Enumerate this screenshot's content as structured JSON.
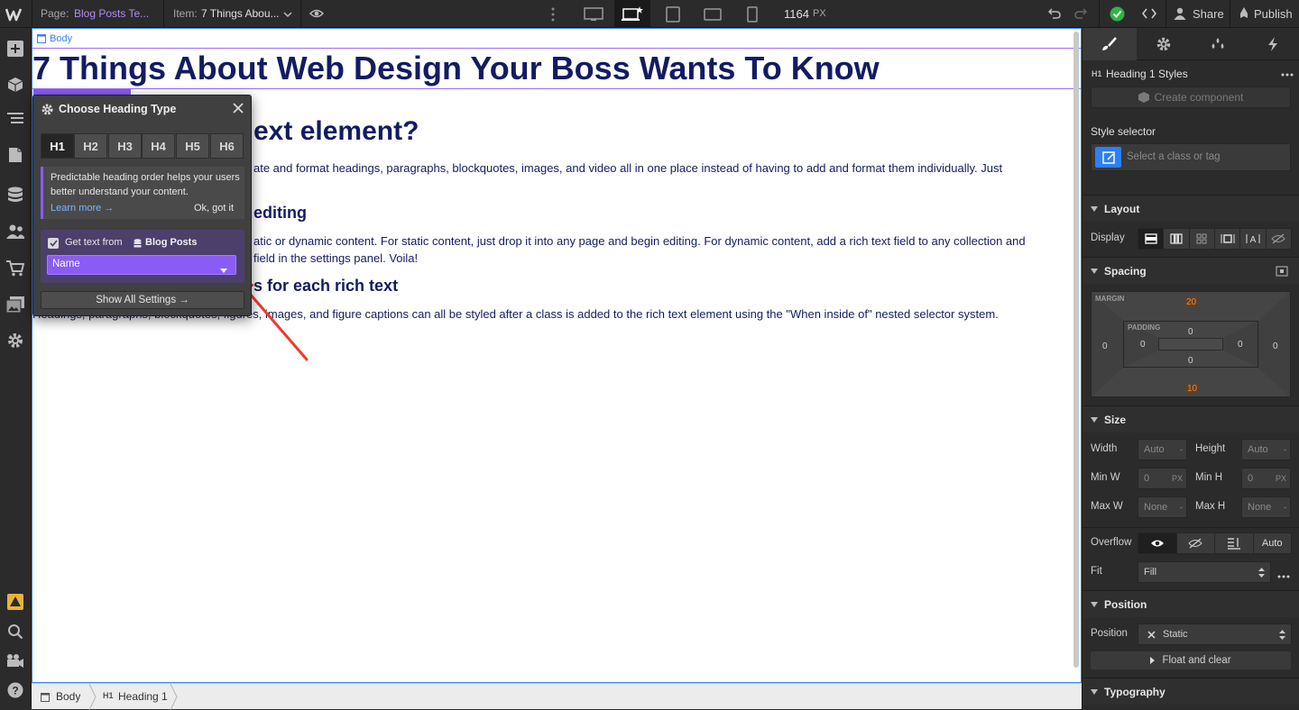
{
  "topbar": {
    "page_label": "Page:",
    "page_value": "Blog Posts Te...",
    "item_label": "Item:",
    "item_value": "7 Things Abou...",
    "width_value": "1164",
    "width_unit": "PX",
    "share_label": "Share",
    "publish_label": "Publish",
    "devices": [
      "desktop-large",
      "desktop",
      "tablet",
      "mobile-landscape",
      "mobile-portrait"
    ],
    "active_device": "desktop"
  },
  "left_sidebar": {
    "icons": [
      "add-icon",
      "cube-icon",
      "navigator-icon",
      "pages-icon",
      "cms-icon",
      "users-icon",
      "ecommerce-icon",
      "assets-icon",
      "settings-icon"
    ],
    "bottom_icons": [
      "warning-icon",
      "search-icon",
      "video-icon",
      "help-icon"
    ]
  },
  "canvas": {
    "body_label": "Body",
    "heading_tag": "Heading 1",
    "h1": "7 Things About Web Design Your Boss Wants To Know",
    "h2": "ext element?",
    "p1": "ate and format headings, paragraphs, blockquotes, images, and video all in one place instead of having to add and format them individually. Just",
    "h3a": "editing",
    "p2a": "atic or dynamic content. For static content, just drop it into any page and begin editing. For dynamic content, add a rich text field to any collection and",
    "p2b": "field in the settings panel. Voila!",
    "h3b": "s for each rich text",
    "p3": "Headings, paragraphs, blockquotes, figures, images, and figure captions can all be styled after a class is added to the rich text element using the \"When inside of\" nested selector system."
  },
  "heading_panel": {
    "title": "Choose Heading Type",
    "tabs": [
      "H1",
      "H2",
      "H3",
      "H4",
      "H5",
      "H6"
    ],
    "active_tab": "H1",
    "tip": "Predictable heading order helps your users better understand your content.",
    "learn_more": "Learn more →",
    "ok": "Ok, got it",
    "get_text_label": "Get text from",
    "collection": "Blog Posts",
    "field_value": "Name",
    "show_all": "Show All Settings →",
    "accent": "#8a5cf5"
  },
  "breadcrumbs": {
    "items": [
      "Body",
      "Heading 1"
    ],
    "h1_badge": "H1"
  },
  "right_panel": {
    "tabs": [
      "style-brush-icon",
      "gear-icon",
      "drops-icon",
      "lightning-icon"
    ],
    "element_badge": "H1",
    "element_title": "Heading 1 Styles",
    "create_component": "Create component",
    "style_selector_label": "Style selector",
    "style_selector_placeholder": "Select a class or tag",
    "layout": {
      "title": "Layout",
      "display_label": "Display"
    },
    "spacing": {
      "title": "Spacing",
      "margin_label": "MARGIN",
      "padding_label": "PADDING",
      "margin_top": "20",
      "margin_bottom": "10",
      "margin_left": "0",
      "margin_right": "0",
      "padding_top": "0",
      "padding_bottom": "0",
      "padding_left": "0",
      "padding_right": "0"
    },
    "size": {
      "title": "Size",
      "width_label": "Width",
      "width_value": "Auto",
      "height_label": "Height",
      "height_value": "Auto",
      "minw_label": "Min W",
      "minw_value": "0",
      "minh_label": "Min H",
      "minh_value": "0",
      "maxw_label": "Max W",
      "maxw_value": "None",
      "maxh_label": "Max H",
      "maxh_value": "None",
      "unit_px": "PX",
      "unit_dash": "-",
      "overflow_label": "Overflow",
      "overflow_auto": "Auto",
      "fit_label": "Fit",
      "fit_value": "Fill"
    },
    "position": {
      "title": "Position",
      "position_label": "Position",
      "position_value": "Static",
      "float_label": "Float and clear"
    },
    "typography": {
      "title": "Typography"
    },
    "accent_blue": "#2d7ff9",
    "margin_color": "#f08a24"
  }
}
